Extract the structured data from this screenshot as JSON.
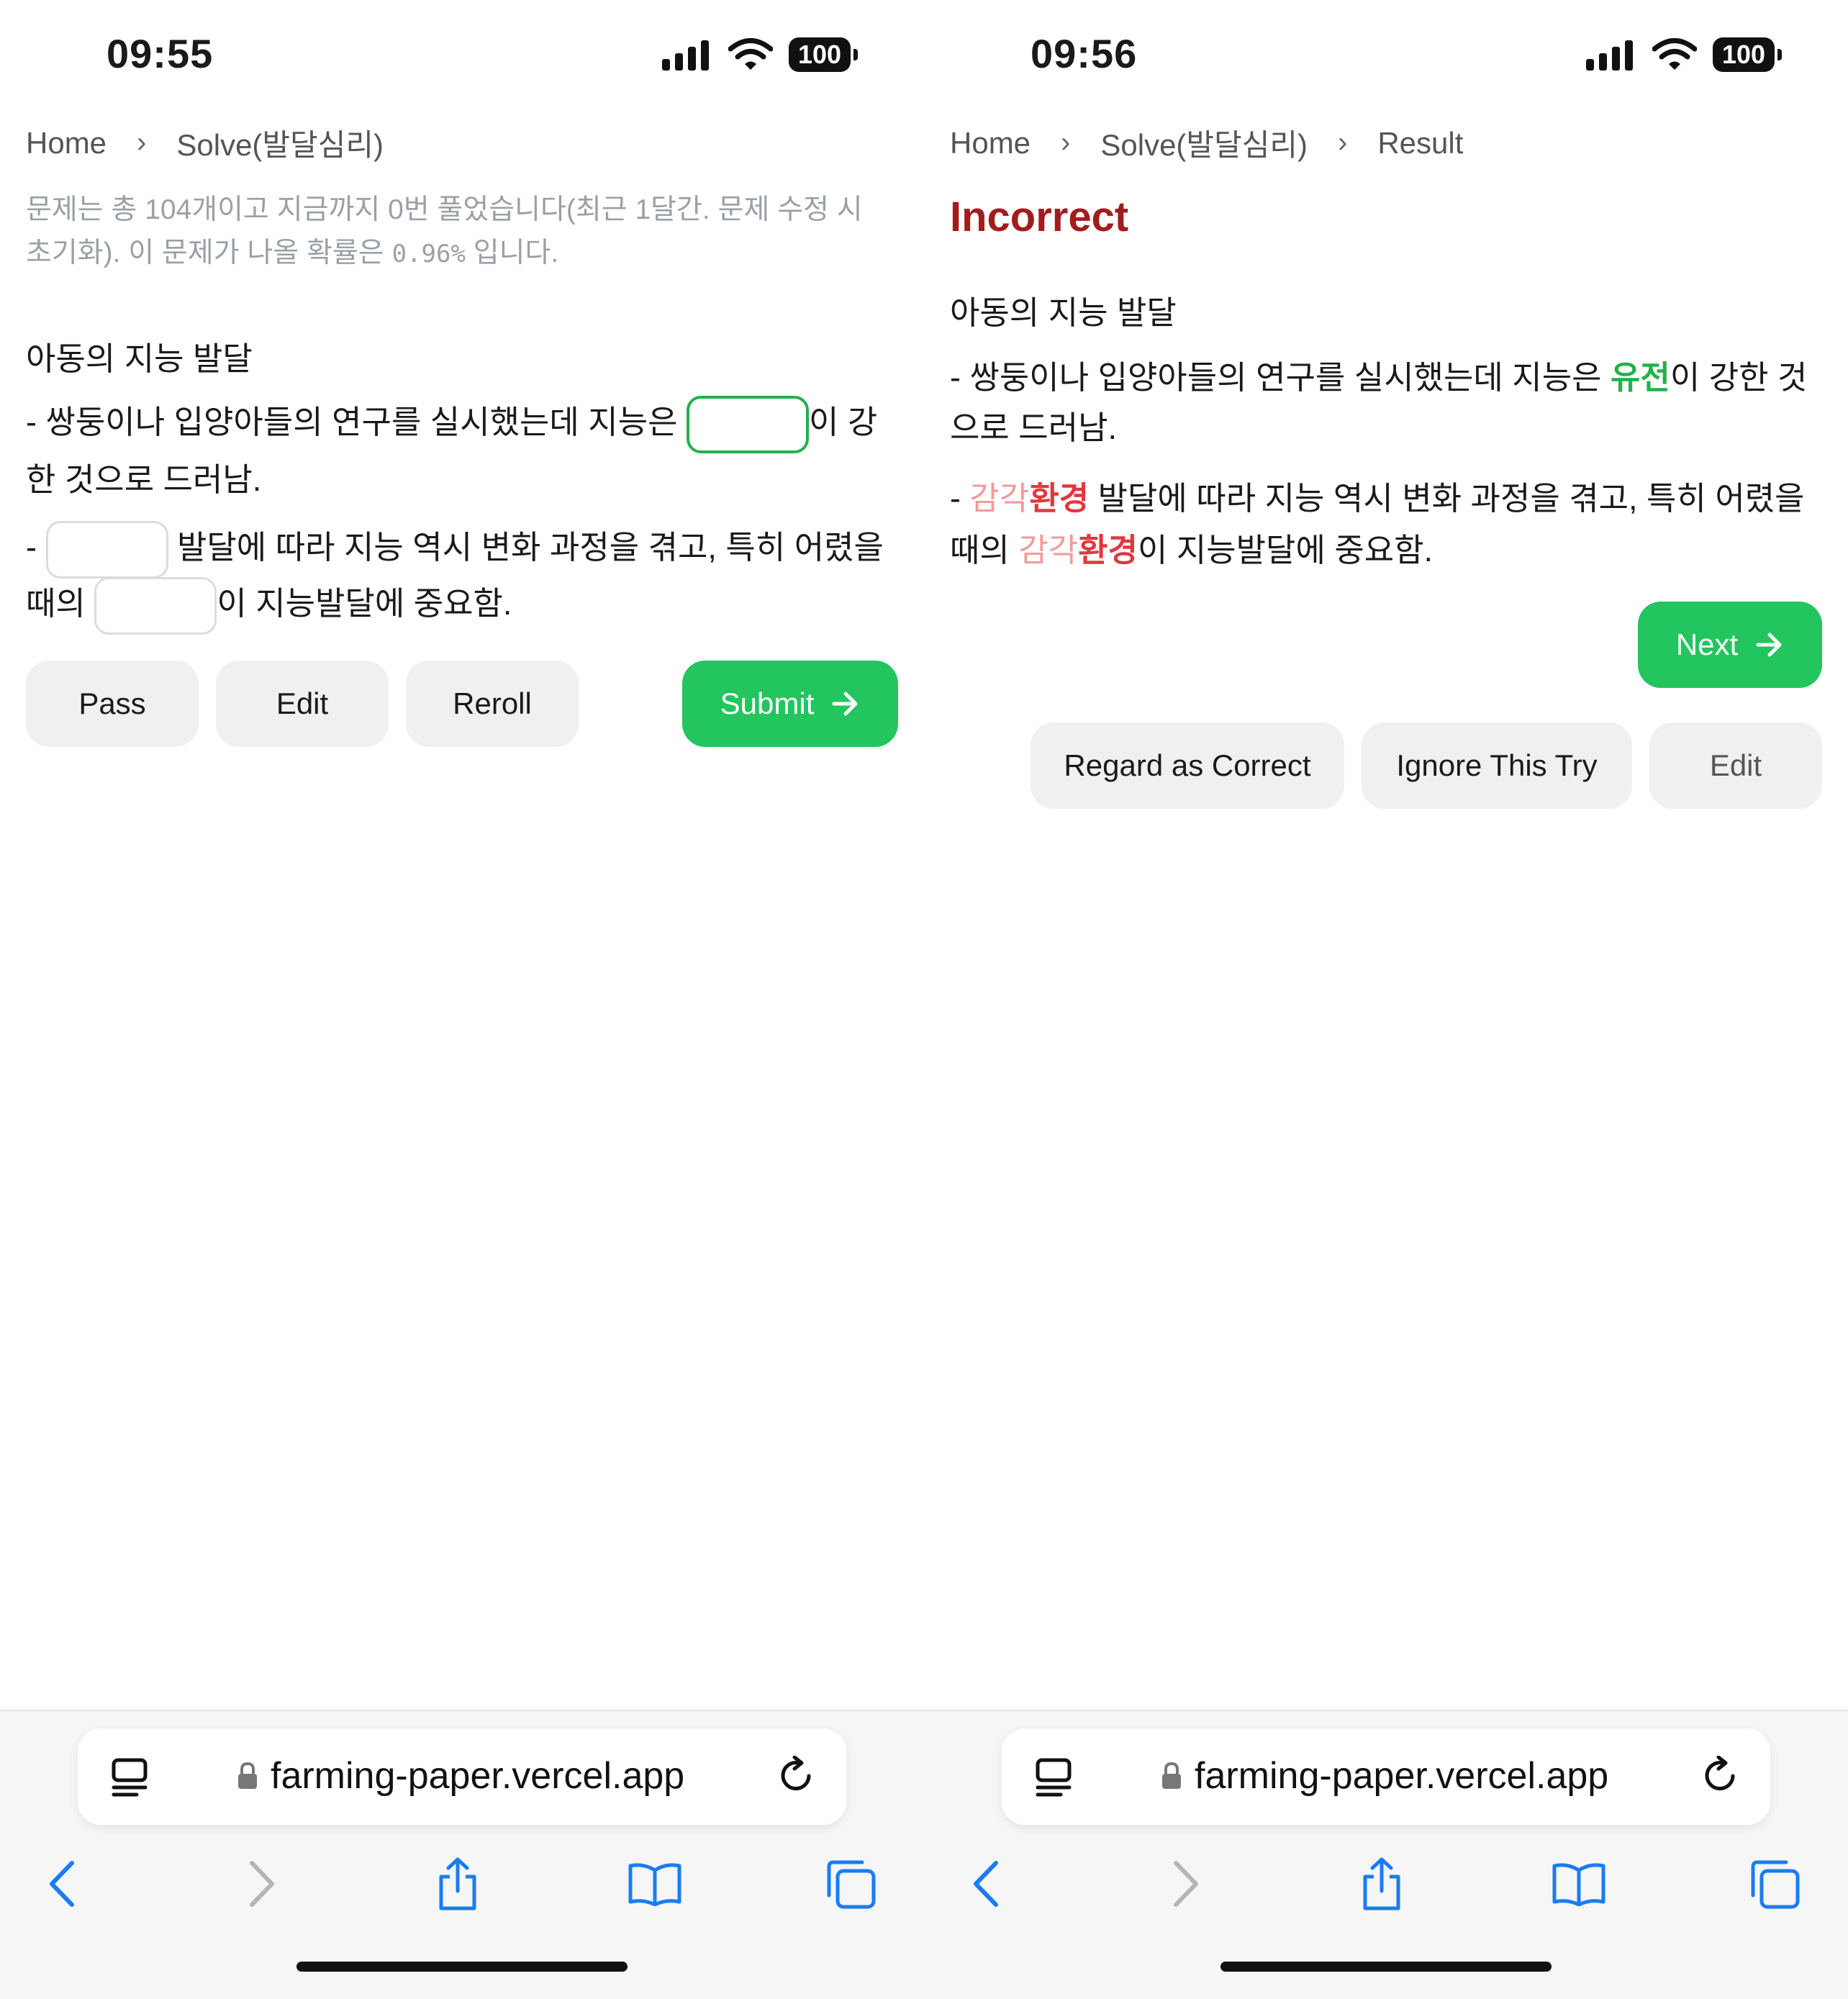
{
  "left": {
    "status": {
      "time": "09:55",
      "battery": "100"
    },
    "breadcrumb": [
      "Home",
      "Solve(발달심리)"
    ],
    "info": {
      "line1": "문제는 총 104개이고 지금까지 0번 풀었습니다(최근 1달간. 문제 수정 시",
      "line2_pre": "초기화). 이 문제가 나올 확률은 ",
      "probability": "0.96%",
      "line2_post": " 입니다."
    },
    "question": {
      "title": "아동의 지능 발달",
      "l1_pre": "- 쌍둥이나 입양아들의 연구를 실시했는데 지능은 ",
      "l1_post": "이 강",
      "l2": "한 것으로 드러남.",
      "l3_pre": "- ",
      "l3_post": " 발달에 따라 지능 역시 변화 과정을 겪고, 특히 어렸을",
      "l4_pre": "때의 ",
      "l4_post": "이 지능발달에 중요함."
    },
    "buttons": {
      "pass": "Pass",
      "edit": "Edit",
      "reroll": "Reroll",
      "submit": "Submit"
    },
    "url": "farming-paper.vercel.app"
  },
  "right": {
    "status": {
      "time": "09:56",
      "battery": "100"
    },
    "breadcrumb": [
      "Home",
      "Solve(발달심리)",
      "Result"
    ],
    "result_title": "Incorrect",
    "question": {
      "title": "아동의 지능 발달",
      "l1_pre": "- 쌍둥이나 입양아들의 연구를 실시했는데 지능은 ",
      "l1_answer": "유전",
      "l1_post": "이 강한 것",
      "l2": "으로 드러남.",
      "l3_pre": "- ",
      "l3_wrong": "감각",
      "l3_answer": "환경",
      "l3_post": " 발달에 따라 지능 역시 변화 과정을 겪고, 특히 어렸을",
      "l4_pre": "때의 ",
      "l4_wrong": "감각",
      "l4_answer": "환경",
      "l4_post": "이 지능발달에 중요함."
    },
    "buttons": {
      "next": "Next",
      "regard_correct": "Regard as Correct",
      "ignore_try": "Ignore This Try",
      "edit": "Edit"
    },
    "url": "farming-paper.vercel.app"
  },
  "colors": {
    "accent_green": "#22c55e",
    "incorrect_red": "#a11d1d",
    "wrong_pink": "#f29a9a",
    "answer_red": "#e0383e"
  },
  "icons": [
    "signal-icon",
    "wifi-icon",
    "battery-icon",
    "chevron-right-icon",
    "arrow-right-icon",
    "reader-icon",
    "lock-icon",
    "reload-icon",
    "back-icon",
    "forward-icon",
    "share-icon",
    "bookmarks-icon",
    "tabs-icon"
  ]
}
